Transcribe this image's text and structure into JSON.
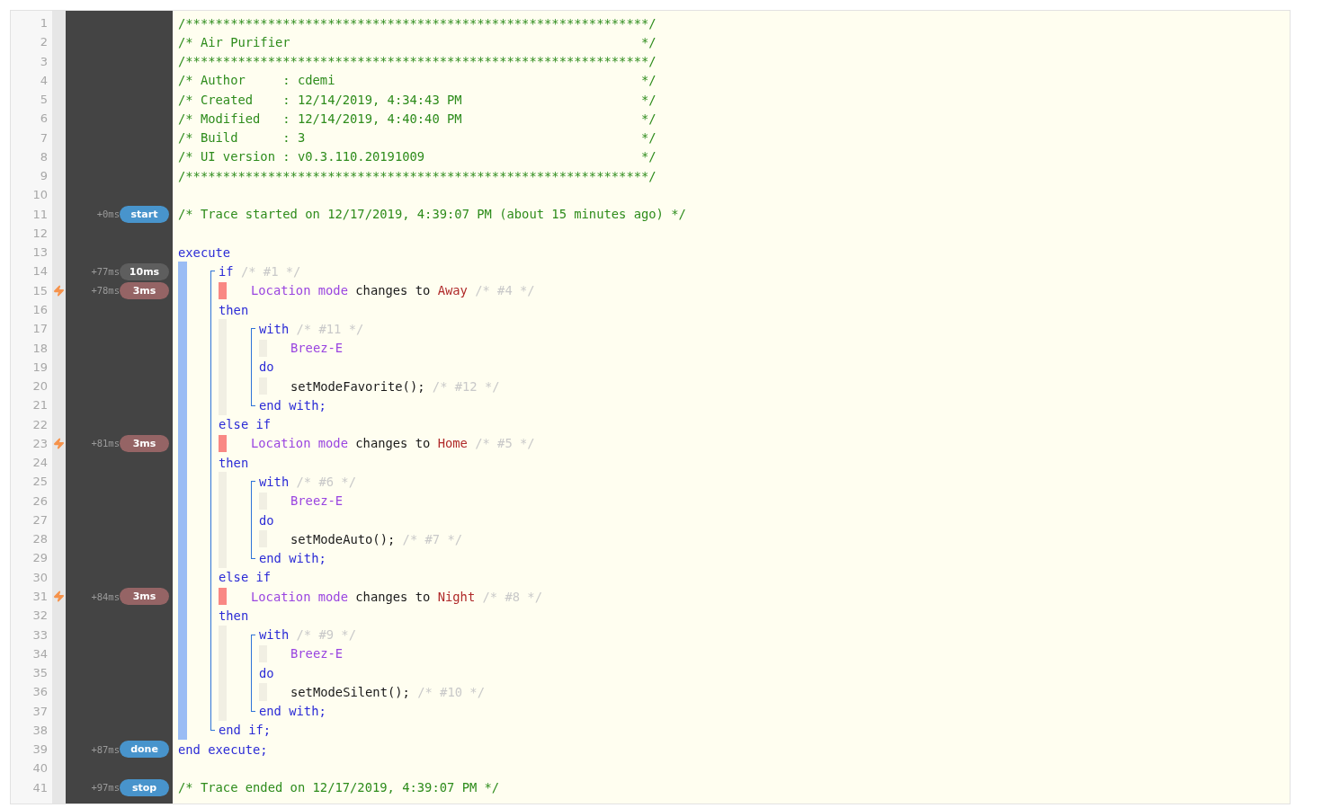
{
  "lines": [
    {
      "number": "1",
      "trigger": false,
      "tokens": [
        {
          "text": "/**************************************************************/",
          "kind": "comment"
        }
      ]
    },
    {
      "number": "2",
      "trigger": false,
      "tokens": [
        {
          "text": "/* Air Purifier                                               */",
          "kind": "comment"
        }
      ]
    },
    {
      "number": "3",
      "trigger": false,
      "tokens": [
        {
          "text": "/**************************************************************/",
          "kind": "comment"
        }
      ]
    },
    {
      "number": "4",
      "trigger": false,
      "tokens": [
        {
          "text": "/* Author     : cdemi                                         */",
          "kind": "comment"
        }
      ]
    },
    {
      "number": "5",
      "trigger": false,
      "tokens": [
        {
          "text": "/* Created    : 12/14/2019, 4:34:43 PM                        */",
          "kind": "comment"
        }
      ]
    },
    {
      "number": "6",
      "trigger": false,
      "tokens": [
        {
          "text": "/* Modified   : 12/14/2019, 4:40:40 PM                        */",
          "kind": "comment"
        }
      ]
    },
    {
      "number": "7",
      "trigger": false,
      "tokens": [
        {
          "text": "/* Build      : 3                                             */",
          "kind": "comment"
        }
      ]
    },
    {
      "number": "8",
      "trigger": false,
      "tokens": [
        {
          "text": "/* UI version : v0.3.110.20191009                             */",
          "kind": "comment"
        }
      ]
    },
    {
      "number": "9",
      "trigger": false,
      "tokens": [
        {
          "text": "/**************************************************************/",
          "kind": "comment"
        }
      ]
    },
    {
      "number": "10",
      "trigger": false
    },
    {
      "number": "11",
      "trigger": false,
      "time": "+0ms",
      "badge": {
        "text": "start",
        "kind": "event"
      },
      "tokens": [
        {
          "text": "/* Trace started on 12/17/2019, 4:39:07 PM (about 15 minutes ago) */",
          "kind": "comment"
        }
      ]
    },
    {
      "number": "12",
      "trigger": false
    },
    {
      "number": "13",
      "trigger": false,
      "tokens": [
        {
          "text": "execute",
          "kind": "keyword"
        }
      ]
    },
    {
      "number": "14",
      "trigger": false,
      "time": "+77ms",
      "badge": {
        "text": "10ms",
        "kind": "duration"
      },
      "guides": [
        {
          "kind": "exec"
        },
        {
          "kind": "if-start"
        }
      ],
      "tokens": [
        {
          "text": "if",
          "kind": "keyword"
        },
        {
          "text": "/* #1 */",
          "kind": "note"
        }
      ]
    },
    {
      "number": "15",
      "trigger": true,
      "time": "+78ms",
      "badge": {
        "text": "3ms",
        "kind": "condition"
      },
      "guides": [
        {
          "kind": "exec"
        },
        {
          "kind": "if"
        },
        {
          "kind": "cond"
        }
      ],
      "tokens": [
        {
          "text": "Location mode",
          "kind": "attribute"
        },
        {
          "text": "changes to",
          "kind": "plain"
        },
        {
          "text": "Away",
          "kind": "value"
        },
        {
          "text": "/* #4 */",
          "kind": "note"
        }
      ]
    },
    {
      "number": "16",
      "trigger": false,
      "guides": [
        {
          "kind": "exec"
        },
        {
          "kind": "if"
        }
      ],
      "tokens": [
        {
          "text": "then",
          "kind": "keyword"
        }
      ]
    },
    {
      "number": "17",
      "trigger": false,
      "guides": [
        {
          "kind": "exec"
        },
        {
          "kind": "if"
        },
        {
          "kind": "then"
        },
        {
          "kind": "with-start"
        }
      ],
      "tokens": [
        {
          "text": "with",
          "kind": "keyword"
        },
        {
          "text": "/* #11 */",
          "kind": "note"
        }
      ]
    },
    {
      "number": "18",
      "trigger": false,
      "guides": [
        {
          "kind": "exec"
        },
        {
          "kind": "if"
        },
        {
          "kind": "then"
        },
        {
          "kind": "with"
        },
        {
          "kind": "stmt"
        }
      ],
      "tokens": [
        {
          "text": "Breez-E",
          "kind": "attribute"
        }
      ]
    },
    {
      "number": "19",
      "trigger": false,
      "guides": [
        {
          "kind": "exec"
        },
        {
          "kind": "if"
        },
        {
          "kind": "then"
        },
        {
          "kind": "with"
        }
      ],
      "tokens": [
        {
          "text": "do",
          "kind": "keyword"
        }
      ]
    },
    {
      "number": "20",
      "trigger": false,
      "guides": [
        {
          "kind": "exec"
        },
        {
          "kind": "if"
        },
        {
          "kind": "then"
        },
        {
          "kind": "with"
        },
        {
          "kind": "stmt"
        }
      ],
      "tokens": [
        {
          "text": "setModeFavorite();",
          "kind": "plain"
        },
        {
          "text": "/* #12 */",
          "kind": "note"
        }
      ]
    },
    {
      "number": "21",
      "trigger": false,
      "guides": [
        {
          "kind": "exec"
        },
        {
          "kind": "if"
        },
        {
          "kind": "then"
        },
        {
          "kind": "with-end"
        }
      ],
      "tokens": [
        {
          "text": "end with;",
          "kind": "keyword"
        }
      ]
    },
    {
      "number": "22",
      "trigger": false,
      "guides": [
        {
          "kind": "exec"
        },
        {
          "kind": "if"
        }
      ],
      "tokens": [
        {
          "text": "else if",
          "kind": "keyword"
        }
      ]
    },
    {
      "number": "23",
      "trigger": true,
      "time": "+81ms",
      "badge": {
        "text": "3ms",
        "kind": "condition"
      },
      "guides": [
        {
          "kind": "exec"
        },
        {
          "kind": "if"
        },
        {
          "kind": "cond"
        }
      ],
      "tokens": [
        {
          "text": "Location mode",
          "kind": "attribute"
        },
        {
          "text": "changes to",
          "kind": "plain"
        },
        {
          "text": "Home",
          "kind": "value"
        },
        {
          "text": "/* #5 */",
          "kind": "note"
        }
      ]
    },
    {
      "number": "24",
      "trigger": false,
      "guides": [
        {
          "kind": "exec"
        },
        {
          "kind": "if"
        }
      ],
      "tokens": [
        {
          "text": "then",
          "kind": "keyword"
        }
      ]
    },
    {
      "number": "25",
      "trigger": false,
      "guides": [
        {
          "kind": "exec"
        },
        {
          "kind": "if"
        },
        {
          "kind": "then"
        },
        {
          "kind": "with-start"
        }
      ],
      "tokens": [
        {
          "text": "with",
          "kind": "keyword"
        },
        {
          "text": "/* #6 */",
          "kind": "note"
        }
      ]
    },
    {
      "number": "26",
      "trigger": false,
      "guides": [
        {
          "kind": "exec"
        },
        {
          "kind": "if"
        },
        {
          "kind": "then"
        },
        {
          "kind": "with"
        },
        {
          "kind": "stmt"
        }
      ],
      "tokens": [
        {
          "text": "Breez-E",
          "kind": "attribute"
        }
      ]
    },
    {
      "number": "27",
      "trigger": false,
      "guides": [
        {
          "kind": "exec"
        },
        {
          "kind": "if"
        },
        {
          "kind": "then"
        },
        {
          "kind": "with"
        }
      ],
      "tokens": [
        {
          "text": "do",
          "kind": "keyword"
        }
      ]
    },
    {
      "number": "28",
      "trigger": false,
      "guides": [
        {
          "kind": "exec"
        },
        {
          "kind": "if"
        },
        {
          "kind": "then"
        },
        {
          "kind": "with"
        },
        {
          "kind": "stmt"
        }
      ],
      "tokens": [
        {
          "text": "setModeAuto();",
          "kind": "plain"
        },
        {
          "text": "/* #7 */",
          "kind": "note"
        }
      ]
    },
    {
      "number": "29",
      "trigger": false,
      "guides": [
        {
          "kind": "exec"
        },
        {
          "kind": "if"
        },
        {
          "kind": "then"
        },
        {
          "kind": "with-end"
        }
      ],
      "tokens": [
        {
          "text": "end with;",
          "kind": "keyword"
        }
      ]
    },
    {
      "number": "30",
      "trigger": false,
      "guides": [
        {
          "kind": "exec"
        },
        {
          "kind": "if"
        }
      ],
      "tokens": [
        {
          "text": "else if",
          "kind": "keyword"
        }
      ]
    },
    {
      "number": "31",
      "trigger": true,
      "time": "+84ms",
      "badge": {
        "text": "3ms",
        "kind": "condition"
      },
      "guides": [
        {
          "kind": "exec"
        },
        {
          "kind": "if"
        },
        {
          "kind": "cond"
        }
      ],
      "tokens": [
        {
          "text": "Location mode",
          "kind": "attribute"
        },
        {
          "text": "changes to",
          "kind": "plain"
        },
        {
          "text": "Night",
          "kind": "value"
        },
        {
          "text": "/* #8 */",
          "kind": "note"
        }
      ]
    },
    {
      "number": "32",
      "trigger": false,
      "guides": [
        {
          "kind": "exec"
        },
        {
          "kind": "if"
        }
      ],
      "tokens": [
        {
          "text": "then",
          "kind": "keyword"
        }
      ]
    },
    {
      "number": "33",
      "trigger": false,
      "guides": [
        {
          "kind": "exec"
        },
        {
          "kind": "if"
        },
        {
          "kind": "then"
        },
        {
          "kind": "with-start"
        }
      ],
      "tokens": [
        {
          "text": "with",
          "kind": "keyword"
        },
        {
          "text": "/* #9 */",
          "kind": "note"
        }
      ]
    },
    {
      "number": "34",
      "trigger": false,
      "guides": [
        {
          "kind": "exec"
        },
        {
          "kind": "if"
        },
        {
          "kind": "then"
        },
        {
          "kind": "with"
        },
        {
          "kind": "stmt"
        }
      ],
      "tokens": [
        {
          "text": "Breez-E",
          "kind": "attribute"
        }
      ]
    },
    {
      "number": "35",
      "trigger": false,
      "guides": [
        {
          "kind": "exec"
        },
        {
          "kind": "if"
        },
        {
          "kind": "then"
        },
        {
          "kind": "with"
        }
      ],
      "tokens": [
        {
          "text": "do",
          "kind": "keyword"
        }
      ]
    },
    {
      "number": "36",
      "trigger": false,
      "guides": [
        {
          "kind": "exec"
        },
        {
          "kind": "if"
        },
        {
          "kind": "then"
        },
        {
          "kind": "with"
        },
        {
          "kind": "stmt"
        }
      ],
      "tokens": [
        {
          "text": "setModeSilent();",
          "kind": "plain"
        },
        {
          "text": "/* #10 */",
          "kind": "note"
        }
      ]
    },
    {
      "number": "37",
      "trigger": false,
      "guides": [
        {
          "kind": "exec"
        },
        {
          "kind": "if"
        },
        {
          "kind": "then"
        },
        {
          "kind": "with-end"
        }
      ],
      "tokens": [
        {
          "text": "end with;",
          "kind": "keyword"
        }
      ]
    },
    {
      "number": "38",
      "trigger": false,
      "guides": [
        {
          "kind": "exec"
        },
        {
          "kind": "if-end"
        }
      ],
      "tokens": [
        {
          "text": "end if;",
          "kind": "keyword"
        }
      ]
    },
    {
      "number": "39",
      "trigger": false,
      "time": "+87ms",
      "badge": {
        "text": "done",
        "kind": "event"
      },
      "tokens": [
        {
          "text": "end execute;",
          "kind": "keyword"
        }
      ]
    },
    {
      "number": "40",
      "trigger": false
    },
    {
      "number": "41",
      "trigger": false,
      "time": "+97ms",
      "badge": {
        "text": "stop",
        "kind": "event"
      },
      "tokens": [
        {
          "text": "/* Trace ended on 12/17/2019, 4:39:07 PM */",
          "kind": "comment"
        }
      ]
    }
  ]
}
